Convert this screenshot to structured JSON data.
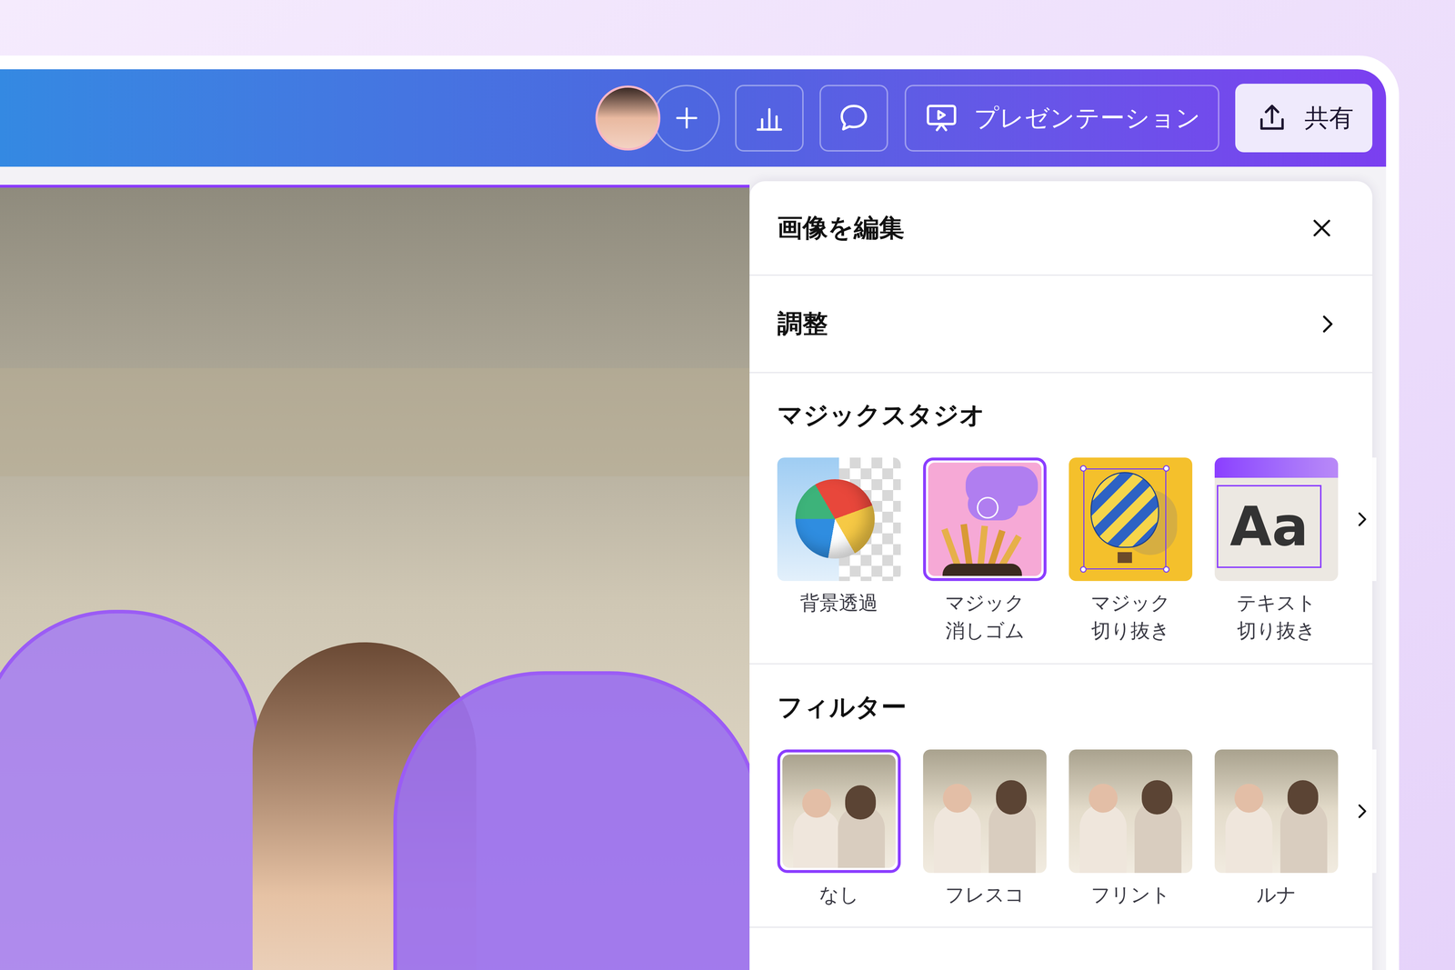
{
  "toolbar": {
    "present": {
      "label": "プレゼンテーション"
    },
    "share": {
      "label": "共有"
    }
  },
  "panel": {
    "title": "画像を編集",
    "adjust": {
      "label": "調整"
    },
    "magic_studio": {
      "heading": "マジックスタジオ",
      "tools": [
        {
          "label": "背景透過",
          "selected": false,
          "kind": "bg-remove"
        },
        {
          "label": "マジック\n消しゴム",
          "selected": true,
          "kind": "eraser"
        },
        {
          "label": "マジック\n切り抜き",
          "selected": false,
          "kind": "grab"
        },
        {
          "label": "テキスト\n切り抜き",
          "selected": false,
          "kind": "text-cutout",
          "art_text": "Aa"
        }
      ]
    },
    "filters": {
      "heading": "フィルター",
      "items": [
        {
          "label": "なし",
          "selected": true
        },
        {
          "label": "フレスコ",
          "selected": false
        },
        {
          "label": "フリント",
          "selected": false
        },
        {
          "label": "ルナ",
          "selected": false
        }
      ]
    }
  }
}
